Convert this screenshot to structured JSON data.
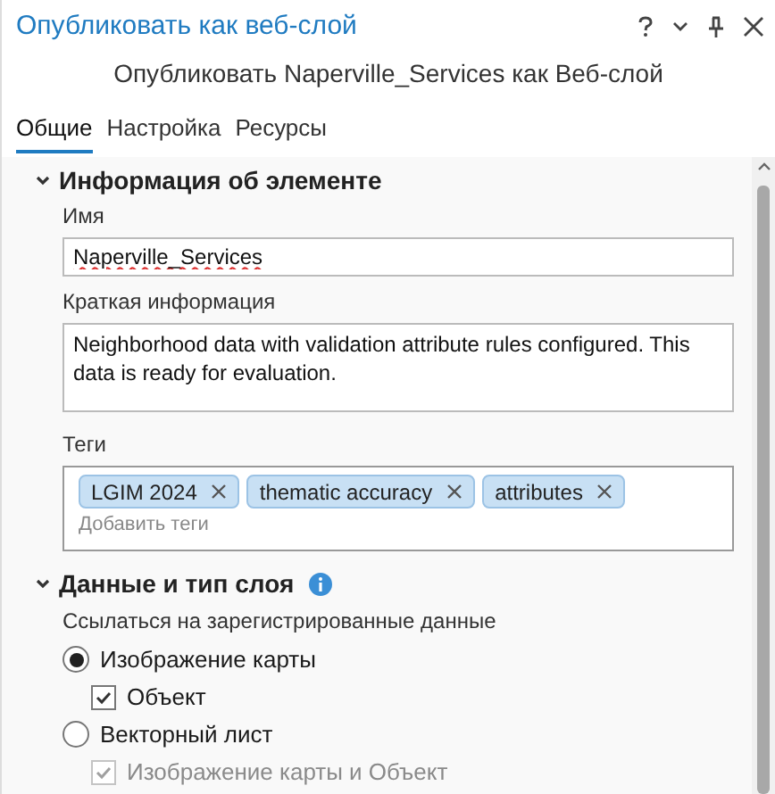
{
  "window": {
    "title": "Опубликовать как веб-слой",
    "subtitle": "Опубликовать Naperville_Services как Веб-слой"
  },
  "tabs": [
    {
      "label": "Общие",
      "selected": true
    },
    {
      "label": "Настройка",
      "selected": false
    },
    {
      "label": "Ресурсы",
      "selected": false
    }
  ],
  "item_info": {
    "title": "Информация об элементе",
    "expanded": true,
    "name_label": "Имя",
    "name_value": "Naperville_Services",
    "summary_label": "Краткая информация",
    "summary_value": "Neighborhood data with validation attribute rules configured. This data is ready for evaluation.",
    "tags_label": "Теги",
    "tags": [
      "LGIM 2024",
      "thematic accuracy",
      "attributes"
    ],
    "tags_placeholder": "Добавить теги"
  },
  "data_section": {
    "title": "Данные и тип слоя",
    "expanded": true,
    "caption": "Ссылаться на зарегистрированные данные",
    "options": [
      {
        "kind": "radio",
        "label": "Изображение карты",
        "checked": true,
        "disabled": false,
        "children": [
          {
            "kind": "checkbox",
            "label": "Объект",
            "checked": true,
            "disabled": false
          }
        ]
      },
      {
        "kind": "radio",
        "label": "Векторный лист",
        "checked": false,
        "disabled": false,
        "children": [
          {
            "kind": "checkbox",
            "label": "Изображение карты и Объект",
            "checked": true,
            "disabled": true
          }
        ]
      }
    ]
  }
}
